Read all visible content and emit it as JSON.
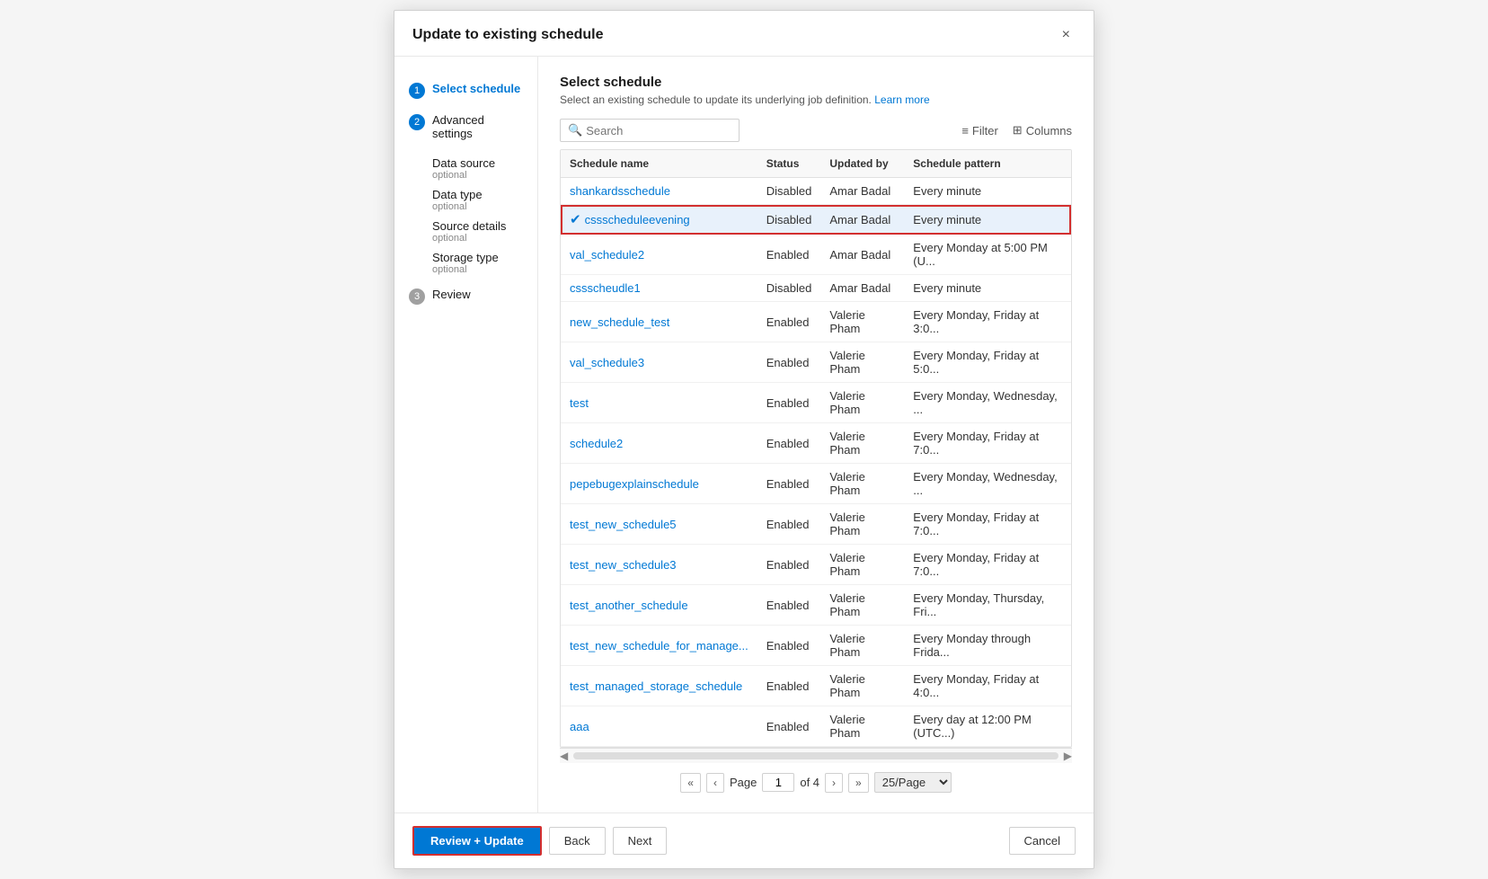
{
  "dialog": {
    "title": "Update to existing schedule",
    "close_label": "×"
  },
  "sidebar": {
    "steps": [
      {
        "num": "1",
        "label": "Select schedule",
        "active": true,
        "gray": false
      }
    ],
    "step2_label": "Advanced settings",
    "step2_num": "2",
    "step2_gray": false,
    "nested_items": [
      {
        "label": "Data source",
        "optional": "optional"
      },
      {
        "label": "Data type",
        "optional": "optional"
      },
      {
        "label": "Source details",
        "optional": "optional"
      },
      {
        "label": "Storage type",
        "optional": "optional"
      }
    ],
    "step3_label": "Review",
    "step3_num": "3",
    "step3_gray": true
  },
  "main": {
    "section_title": "Select schedule",
    "section_desc": "Select an existing schedule to update its underlying job definition.",
    "learn_more": "Learn more",
    "search_placeholder": "Search",
    "filter_label": "Filter",
    "columns_label": "Columns",
    "table": {
      "headers": [
        "Schedule name",
        "Status",
        "Updated by",
        "Schedule pattern"
      ],
      "rows": [
        {
          "name": "shankardsschedule",
          "status": "Disabled",
          "updated_by": "Amar Badal",
          "pattern": "Every minute",
          "selected": false
        },
        {
          "name": "cssscheduleevening",
          "status": "Disabled",
          "updated_by": "Amar Badal",
          "pattern": "Every minute",
          "selected": true
        },
        {
          "name": "val_schedule2",
          "status": "Enabled",
          "updated_by": "Amar Badal",
          "pattern": "Every Monday at 5:00 PM (U...",
          "selected": false
        },
        {
          "name": "cssscheudle1",
          "status": "Disabled",
          "updated_by": "Amar Badal",
          "pattern": "Every minute",
          "selected": false
        },
        {
          "name": "new_schedule_test",
          "status": "Enabled",
          "updated_by": "Valerie Pham",
          "pattern": "Every Monday, Friday at 3:0...",
          "selected": false
        },
        {
          "name": "val_schedule3",
          "status": "Enabled",
          "updated_by": "Valerie Pham",
          "pattern": "Every Monday, Friday at 5:0...",
          "selected": false
        },
        {
          "name": "test",
          "status": "Enabled",
          "updated_by": "Valerie Pham",
          "pattern": "Every Monday, Wednesday, ...",
          "selected": false
        },
        {
          "name": "schedule2",
          "status": "Enabled",
          "updated_by": "Valerie Pham",
          "pattern": "Every Monday, Friday at 7:0...",
          "selected": false
        },
        {
          "name": "pepebugexplainschedule",
          "status": "Enabled",
          "updated_by": "Valerie Pham",
          "pattern": "Every Monday, Wednesday, ...",
          "selected": false
        },
        {
          "name": "test_new_schedule5",
          "status": "Enabled",
          "updated_by": "Valerie Pham",
          "pattern": "Every Monday, Friday at 7:0...",
          "selected": false
        },
        {
          "name": "test_new_schedule3",
          "status": "Enabled",
          "updated_by": "Valerie Pham",
          "pattern": "Every Monday, Friday at 7:0...",
          "selected": false
        },
        {
          "name": "test_another_schedule",
          "status": "Enabled",
          "updated_by": "Valerie Pham",
          "pattern": "Every Monday, Thursday, Fri...",
          "selected": false
        },
        {
          "name": "test_new_schedule_for_manage...",
          "status": "Enabled",
          "updated_by": "Valerie Pham",
          "pattern": "Every Monday through Frida...",
          "selected": false
        },
        {
          "name": "test_managed_storage_schedule",
          "status": "Enabled",
          "updated_by": "Valerie Pham",
          "pattern": "Every Monday, Friday at 4:0...",
          "selected": false
        },
        {
          "name": "aaa",
          "status": "Enabled",
          "updated_by": "Valerie Pham",
          "pattern": "Every day at 12:00 PM (UTC...)",
          "selected": false
        }
      ]
    },
    "pagination": {
      "page": "1",
      "of_label": "of 4",
      "per_page": "25/Page"
    }
  },
  "footer": {
    "review_update_label": "Review + Update",
    "back_label": "Back",
    "next_label": "Next",
    "cancel_label": "Cancel"
  }
}
